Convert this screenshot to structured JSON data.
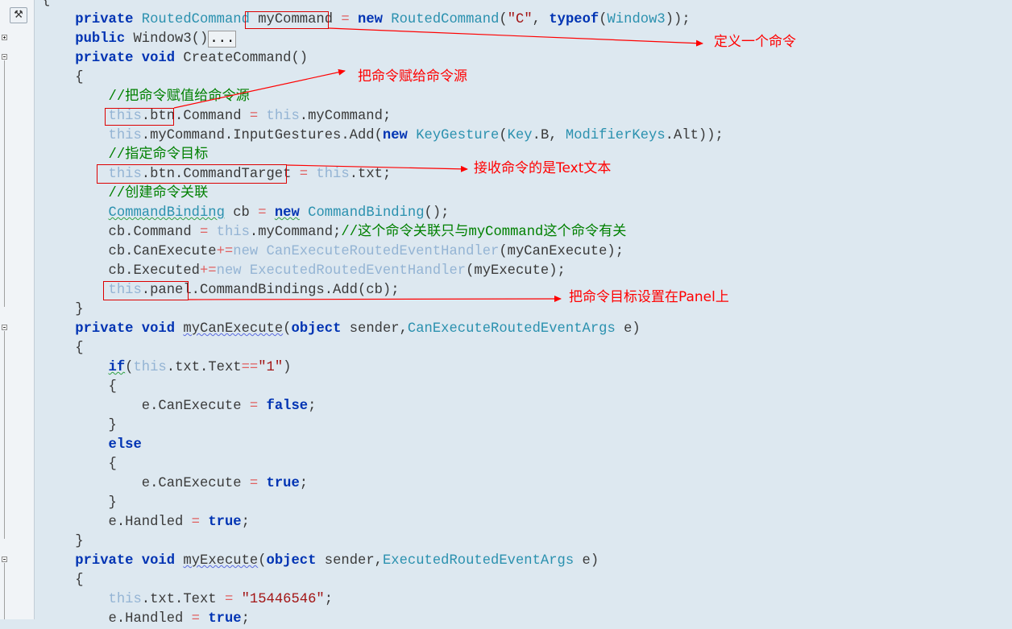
{
  "editor": {
    "tool_icon": "hammer-icon",
    "lines": [
      [
        [
          "p",
          "{"
        ]
      ],
      [
        [
          "p",
          "    "
        ],
        [
          "k",
          "private"
        ],
        [
          "p",
          " "
        ],
        [
          "t",
          "RoutedCommand"
        ],
        [
          "p",
          " myCommand "
        ],
        [
          "op",
          "="
        ],
        [
          "p",
          " "
        ],
        [
          "k",
          "new"
        ],
        [
          "p",
          " "
        ],
        [
          "t",
          "RoutedCommand"
        ],
        [
          "p",
          "("
        ],
        [
          "s",
          "\"C\""
        ],
        [
          "p",
          ", "
        ],
        [
          "k",
          "typeof"
        ],
        [
          "p",
          "("
        ],
        [
          "t",
          "Window3"
        ],
        [
          "p",
          "));"
        ]
      ],
      [
        [
          "p",
          "    "
        ],
        [
          "k",
          "public"
        ],
        [
          "p",
          " Window3()"
        ],
        [
          "coll",
          "..."
        ]
      ],
      [
        [
          "p",
          "    "
        ],
        [
          "k",
          "private"
        ],
        [
          "p",
          " "
        ],
        [
          "k",
          "void"
        ],
        [
          "p",
          " CreateCommand()"
        ]
      ],
      [
        [
          "p",
          "    {"
        ]
      ],
      [
        [
          "p",
          "        "
        ],
        [
          "c",
          "//把命令赋值给命令源"
        ]
      ],
      [
        [
          "p",
          "        "
        ],
        [
          "m",
          "this"
        ],
        [
          "p",
          ".btn.Command "
        ],
        [
          "op",
          "="
        ],
        [
          "p",
          " "
        ],
        [
          "m",
          "this"
        ],
        [
          "p",
          ".myCommand;"
        ]
      ],
      [
        [
          "p",
          "        "
        ],
        [
          "m",
          "this"
        ],
        [
          "p",
          ".myCommand.InputGestures.Add("
        ],
        [
          "k",
          "new"
        ],
        [
          "p",
          " "
        ],
        [
          "t",
          "KeyGesture"
        ],
        [
          "p",
          "("
        ],
        [
          "t",
          "Key"
        ],
        [
          "p",
          ".B, "
        ],
        [
          "t",
          "ModifierKeys"
        ],
        [
          "p",
          ".Alt));"
        ]
      ],
      [
        [
          "p",
          "        "
        ],
        [
          "c",
          "//指定命令目标"
        ]
      ],
      [
        [
          "p",
          "        "
        ],
        [
          "m",
          "this"
        ],
        [
          "p",
          ".btn.CommandTarget "
        ],
        [
          "op",
          "="
        ],
        [
          "p",
          " "
        ],
        [
          "m",
          "this"
        ],
        [
          "p",
          ".txt;"
        ]
      ],
      [
        [
          "p",
          "        "
        ],
        [
          "c",
          "//创建命令关联"
        ]
      ],
      [
        [
          "p",
          "        "
        ],
        [
          "tsq",
          "CommandBinding"
        ],
        [
          "p",
          " cb "
        ],
        [
          "op",
          "="
        ],
        [
          "p",
          " "
        ],
        [
          "ksq",
          "new"
        ],
        [
          "p",
          " "
        ],
        [
          "t",
          "CommandBinding"
        ],
        [
          "p",
          "();"
        ]
      ],
      [
        [
          "p",
          "        cb.Command "
        ],
        [
          "op",
          "="
        ],
        [
          "p",
          " "
        ],
        [
          "m",
          "this"
        ],
        [
          "p",
          ".myCommand;"
        ],
        [
          "c",
          "//这个命令关联只与myCommand这个命令有关"
        ]
      ],
      [
        [
          "p",
          "        cb.CanExecute"
        ],
        [
          "op",
          "+="
        ],
        [
          "m",
          "new"
        ],
        [
          "p",
          " "
        ],
        [
          "m",
          "CanExecuteRoutedEventHandler"
        ],
        [
          "p",
          "(myCanExecute);"
        ]
      ],
      [
        [
          "p",
          "        cb.Executed"
        ],
        [
          "op",
          "+="
        ],
        [
          "m",
          "new"
        ],
        [
          "p",
          " "
        ],
        [
          "m",
          "ExecutedRoutedEventHandler"
        ],
        [
          "p",
          "(myExecute);"
        ]
      ],
      [
        [
          "p",
          "        "
        ],
        [
          "m",
          "this"
        ],
        [
          "p",
          ".panel.CommandBindings.Add(cb);"
        ]
      ],
      [
        [
          "p",
          "    }"
        ]
      ],
      [
        [
          "p",
          "    "
        ],
        [
          "k",
          "private"
        ],
        [
          "p",
          " "
        ],
        [
          "k",
          "void"
        ],
        [
          "p",
          " "
        ],
        [
          "psq",
          "myCanExecute"
        ],
        [
          "p",
          "("
        ],
        [
          "k",
          "object"
        ],
        [
          "p",
          " sender,"
        ],
        [
          "t",
          "CanExecuteRoutedEventArgs"
        ],
        [
          "p",
          " e)"
        ]
      ],
      [
        [
          "p",
          "    {"
        ]
      ],
      [
        [
          "p",
          "        "
        ],
        [
          "ksq",
          "if"
        ],
        [
          "p",
          "("
        ],
        [
          "m",
          "this"
        ],
        [
          "p",
          ".txt.Text"
        ],
        [
          "op",
          "=="
        ],
        [
          "s",
          "\"1\""
        ],
        [
          "p",
          ")"
        ]
      ],
      [
        [
          "p",
          "        {"
        ]
      ],
      [
        [
          "p",
          "            e.CanExecute "
        ],
        [
          "op",
          "="
        ],
        [
          "p",
          " "
        ],
        [
          "k",
          "false"
        ],
        [
          "p",
          ";"
        ]
      ],
      [
        [
          "p",
          "        }"
        ]
      ],
      [
        [
          "p",
          "        "
        ],
        [
          "k",
          "else"
        ]
      ],
      [
        [
          "p",
          "        {"
        ]
      ],
      [
        [
          "p",
          "            e.CanExecute "
        ],
        [
          "op",
          "="
        ],
        [
          "p",
          " "
        ],
        [
          "k",
          "true"
        ],
        [
          "p",
          ";"
        ]
      ],
      [
        [
          "p",
          "        }"
        ]
      ],
      [
        [
          "p",
          "        e.Handled "
        ],
        [
          "op",
          "="
        ],
        [
          "p",
          " "
        ],
        [
          "k",
          "true"
        ],
        [
          "p",
          ";"
        ]
      ],
      [
        [
          "p",
          "    }"
        ]
      ],
      [
        [
          "p",
          "    "
        ],
        [
          "k",
          "private"
        ],
        [
          "p",
          " "
        ],
        [
          "k",
          "void"
        ],
        [
          "p",
          " "
        ],
        [
          "psq",
          "myExecute"
        ],
        [
          "p",
          "("
        ],
        [
          "k",
          "object"
        ],
        [
          "p",
          " sender,"
        ],
        [
          "t",
          "ExecutedRoutedEventArgs"
        ],
        [
          "p",
          " e)"
        ]
      ],
      [
        [
          "p",
          "    {"
        ]
      ],
      [
        [
          "p",
          "        "
        ],
        [
          "m",
          "this"
        ],
        [
          "p",
          ".txt.Text "
        ],
        [
          "op",
          "="
        ],
        [
          "p",
          " "
        ],
        [
          "s",
          "\"15446546\""
        ],
        [
          "p",
          ";"
        ]
      ],
      [
        [
          "p",
          "        e.Handled "
        ],
        [
          "op",
          "="
        ],
        [
          "p",
          " "
        ],
        [
          "k",
          "true"
        ],
        [
          "p",
          ";"
        ]
      ]
    ]
  },
  "annotations": {
    "define_command": "定义一个命令",
    "assign_source": "把命令赋给命令源",
    "receive_target": "接收命令的是Text文本",
    "panel_target": "把命令目标设置在Panel上"
  },
  "colors": {
    "keyword": "#0033b3",
    "type": "#2b91af",
    "member_this": "#94b4d4",
    "string": "#a31515",
    "comment": "#008000",
    "annotation_red": "#ff0000"
  }
}
